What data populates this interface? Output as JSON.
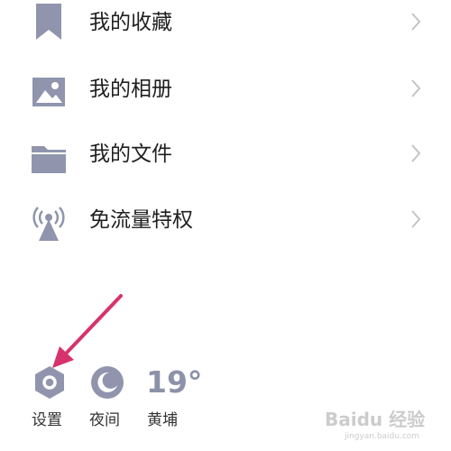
{
  "colors": {
    "icon": "#9095ad",
    "arrow": "#d6336c",
    "chevron": "#c4c4c4",
    "text": "#1f1f1f"
  },
  "menu": [
    {
      "label": "我的收藏",
      "icon": "bookmark-icon"
    },
    {
      "label": "我的相册",
      "icon": "image-icon"
    },
    {
      "label": "我的文件",
      "icon": "folder-icon"
    },
    {
      "label": "免流量特权",
      "icon": "signal-tower-icon"
    }
  ],
  "bottom": {
    "settings_label": "设置",
    "night_label": "夜间",
    "weather_temp": "19°",
    "weather_city": "黄埔"
  },
  "watermark": {
    "main": "Baidu 经验",
    "sub": "jingyan.baidu.com"
  }
}
